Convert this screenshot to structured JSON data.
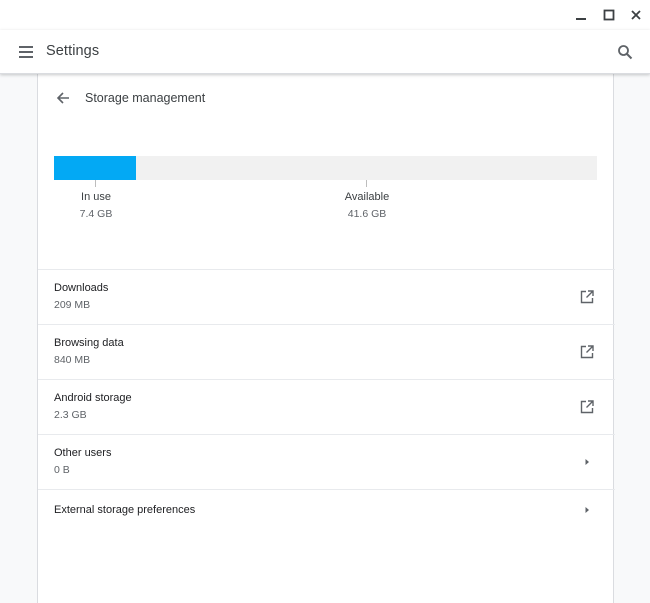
{
  "window": {
    "minimize_icon": "minimize-icon",
    "maximize_icon": "maximize-icon",
    "close_icon": "close-icon"
  },
  "header": {
    "title": "Settings",
    "menu_icon": "hamburger-menu-icon",
    "search_icon": "search-icon"
  },
  "subpage": {
    "title": "Storage management",
    "back_icon": "arrow-back-icon"
  },
  "storage": {
    "in_use_fraction": 0.151,
    "accent_color": "#03a9f4",
    "in_use": {
      "label": "In use",
      "value": "7.4 GB"
    },
    "available": {
      "label": "Available",
      "value": "41.6 GB"
    }
  },
  "items": [
    {
      "label": "Downloads",
      "sub": "209 MB",
      "icon": "open-in-new-icon"
    },
    {
      "label": "Browsing data",
      "sub": "840 MB",
      "icon": "open-in-new-icon"
    },
    {
      "label": "Android storage",
      "sub": "2.3 GB",
      "icon": "open-in-new-icon"
    },
    {
      "label": "Other users",
      "sub": "0 B",
      "icon": "arrow-right-icon"
    },
    {
      "label": "External storage preferences",
      "sub": "",
      "icon": "arrow-right-icon"
    }
  ]
}
